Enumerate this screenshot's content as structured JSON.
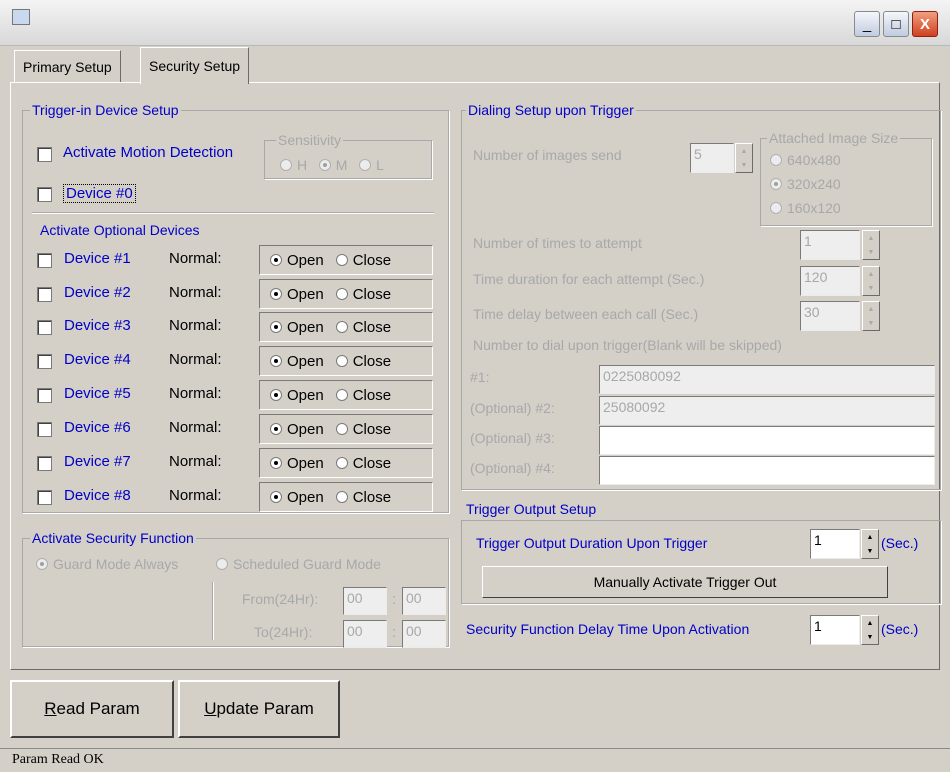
{
  "window": {
    "title": "",
    "minimize_symbol": "_",
    "maximize_symbol": "□",
    "close_symbol": "X"
  },
  "tabs": [
    {
      "label": "Primary Setup",
      "active": false
    },
    {
      "label": "Security Setup",
      "active": true
    }
  ],
  "trigger_in": {
    "title": "Trigger-in Device Setup",
    "motion_label": "Activate Motion Detection",
    "sensitivity_title": "Sensitivity",
    "sensitivity_options": [
      "H",
      "M",
      "L"
    ],
    "sensitivity_selected": "M",
    "device0_label": "Device #0",
    "optional_title": "Activate Optional Devices",
    "devices": [
      {
        "label": "Device #1",
        "normal_label": "Normal:",
        "open_label": "Open",
        "close_label": "Close",
        "selected": "Open"
      },
      {
        "label": "Device #2",
        "normal_label": "Normal:",
        "open_label": "Open",
        "close_label": "Close",
        "selected": "Open"
      },
      {
        "label": "Device #3",
        "normal_label": "Normal:",
        "open_label": "Open",
        "close_label": "Close",
        "selected": "Open"
      },
      {
        "label": "Device #4",
        "normal_label": "Normal:",
        "open_label": "Open",
        "close_label": "Close",
        "selected": "Open"
      },
      {
        "label": "Device #5",
        "normal_label": "Normal:",
        "open_label": "Open",
        "close_label": "Close",
        "selected": "Open"
      },
      {
        "label": "Device #6",
        "normal_label": "Normal:",
        "open_label": "Open",
        "close_label": "Close",
        "selected": "Open"
      },
      {
        "label": "Device #7",
        "normal_label": "Normal:",
        "open_label": "Open",
        "close_label": "Close",
        "selected": "Open"
      },
      {
        "label": "Device #8",
        "normal_label": "Normal:",
        "open_label": "Open",
        "close_label": "Close",
        "selected": "Open"
      }
    ]
  },
  "security_function": {
    "title": "Activate Security Function",
    "guard_always": "Guard Mode Always",
    "scheduled_guard": "Scheduled Guard Mode",
    "selected": "Guard Mode Always",
    "from_label": "From(24Hr):",
    "to_label": "To(24Hr):",
    "from_hour": "00",
    "from_min": "00",
    "to_hour": "00",
    "to_min": "00",
    "colon": ":"
  },
  "dialing": {
    "title": "Dialing Setup upon Trigger",
    "images_label": "Number of images send",
    "images_value": "5",
    "size_title": "Attached Image Size",
    "sizes": [
      "640x480",
      "320x240",
      "160x120"
    ],
    "size_selected": "320x240",
    "attempts_label": "Number of times to attempt",
    "attempts_value": "1",
    "duration_label": "Time duration for each attempt (Sec.)",
    "duration_value": "120",
    "delay_label": "Time delay between each call (Sec.)",
    "delay_value": "30",
    "numbers_label": "Number to dial upon trigger(Blank will be skipped)",
    "numbers": [
      {
        "label": "#1:",
        "value": "0225080092"
      },
      {
        "label": "(Optional) #2:",
        "value": "25080092"
      },
      {
        "label": "(Optional) #3:",
        "value": ""
      },
      {
        "label": "(Optional) #4:",
        "value": ""
      }
    ]
  },
  "trigger_output": {
    "title": "Trigger Output Setup",
    "duration_label": "Trigger Output Duration Upon Trigger",
    "duration_value": "1",
    "unit": "(Sec.)",
    "manual_button": "Manually Activate Trigger Out"
  },
  "security_delay": {
    "label": "Security Function Delay Time Upon Activation",
    "value": "1",
    "unit": "(Sec.)"
  },
  "buttons": {
    "read_mnemonic": "R",
    "read_rest": "ead Param",
    "update_mnemonic": "U",
    "update_rest": "pdate Param"
  },
  "status": "Param Read OK",
  "icons": {
    "spin_up": "▲",
    "spin_down": "▼"
  }
}
